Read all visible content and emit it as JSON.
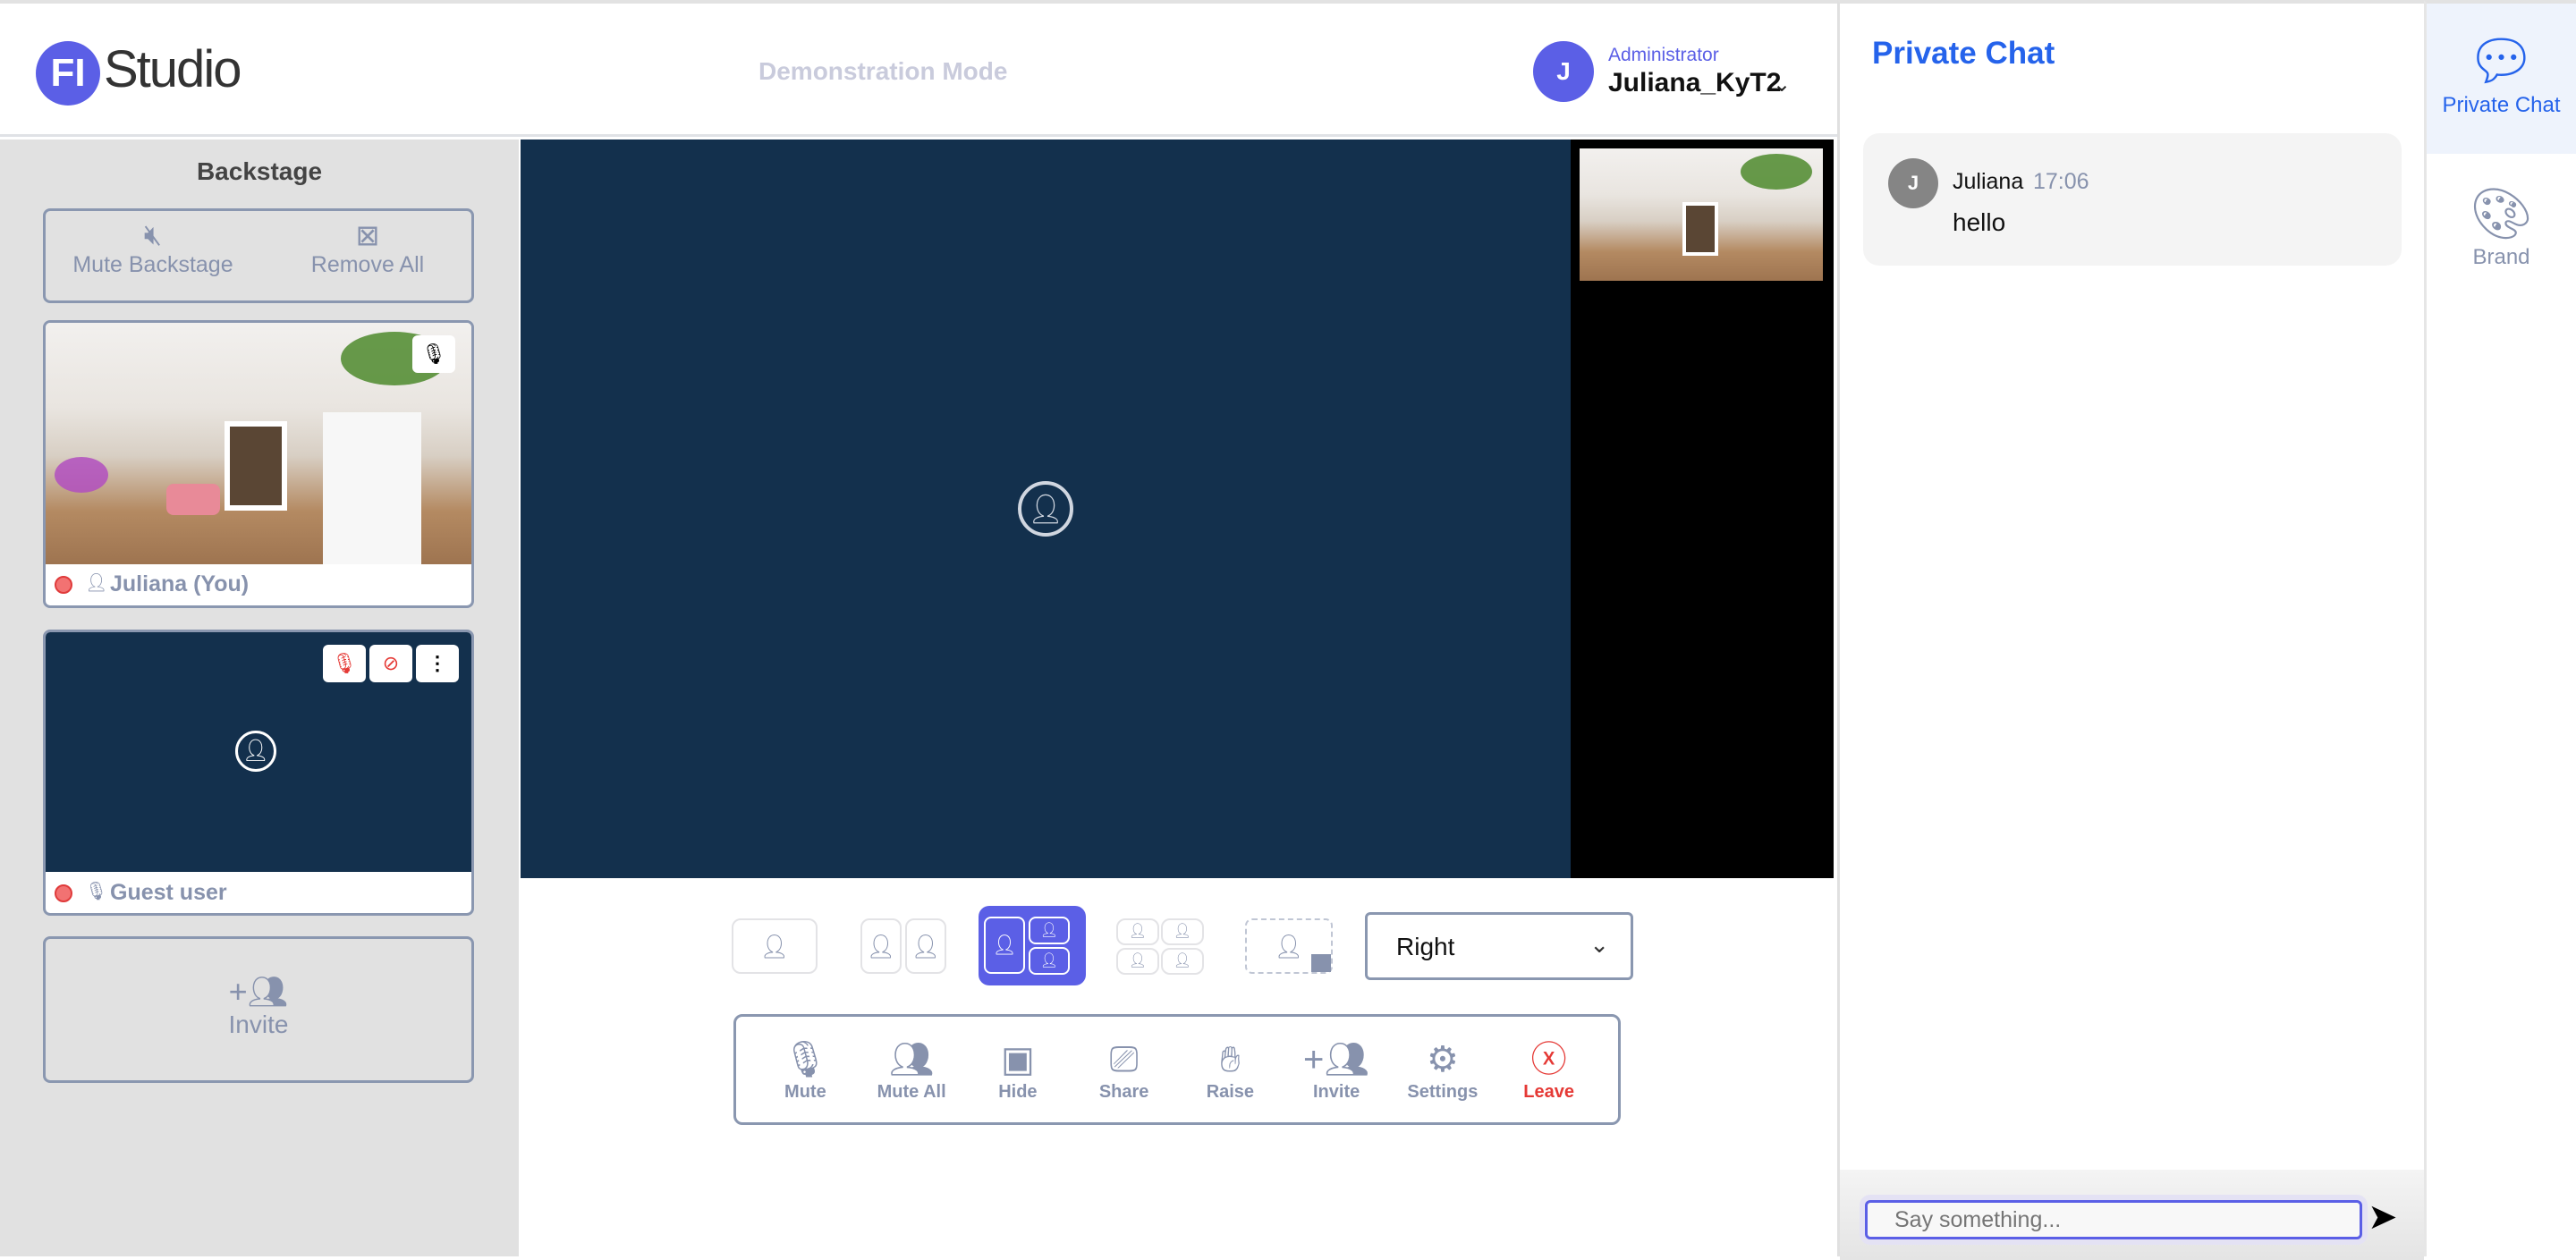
{
  "header": {
    "logo_mark": "FI",
    "logo_text": "Studio",
    "mode": "Demonstration Mode",
    "user": {
      "initial": "J",
      "role": "Administrator",
      "name": "Juliana_KyT2"
    }
  },
  "backstage": {
    "title": "Backstage",
    "mute_label": "Mute Backstage",
    "remove_label": "Remove All",
    "participants": [
      {
        "name": "Juliana (You)",
        "video": "camera-feed"
      },
      {
        "name": "Guest user",
        "video": "off"
      }
    ],
    "invite_label": "Invite"
  },
  "layout": {
    "options": [
      "single",
      "side-by-side",
      "main-plus-two",
      "grid-four",
      "custom"
    ],
    "selected": "main-plus-two",
    "position_value": "Right"
  },
  "controls": [
    {
      "icon": "mic",
      "label": "Mute"
    },
    {
      "icon": "mute-all",
      "label": "Mute All"
    },
    {
      "icon": "video",
      "label": "Hide"
    },
    {
      "icon": "share-screen",
      "label": "Share"
    },
    {
      "icon": "hand",
      "label": "Raise"
    },
    {
      "icon": "add-user",
      "label": "Invite"
    },
    {
      "icon": "gear",
      "label": "Settings"
    },
    {
      "icon": "close-circle",
      "label": "Leave"
    }
  ],
  "chat": {
    "title": "Private Chat",
    "messages": [
      {
        "initial": "J",
        "author": "Juliana",
        "time": "17:06",
        "text": "hello"
      }
    ],
    "input_placeholder": "Say something..."
  },
  "rail": [
    {
      "label": "Private Chat",
      "active": true
    },
    {
      "label": "Brand",
      "active": false
    }
  ],
  "colors": {
    "accent": "#5b5fe6",
    "chat_blue": "#2563eb",
    "stage": "#13304d",
    "danger": "#e53935",
    "muted": "#8792ad"
  }
}
